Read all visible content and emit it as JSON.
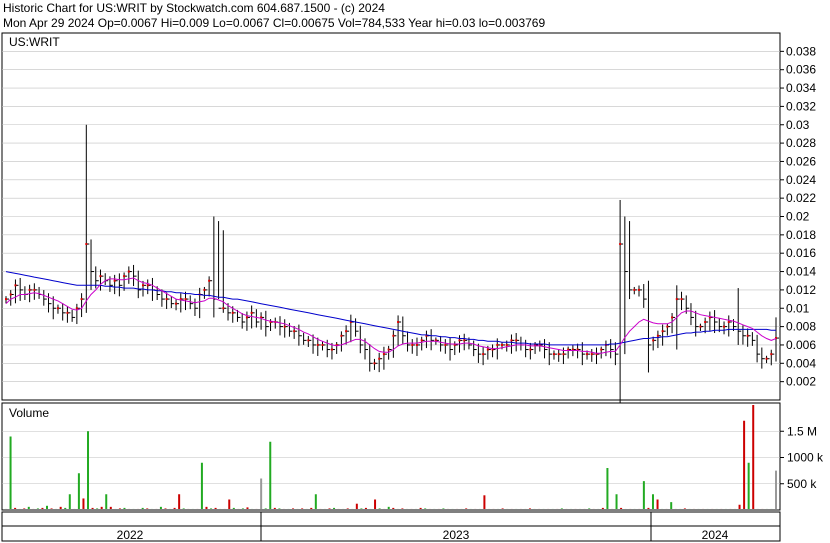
{
  "header": {
    "line1": "Historic Chart for US:WRIT by Stockwatch.com 604.687.1500 - (c) 2024",
    "line2": "Mon Apr 29 2024   Op=0.0067   Hi=0.009   Lo=0.0067   Cl=0.00675   Vol=784,533   Year hi=0.03   lo=0.003769"
  },
  "colors": {
    "price_bar": "#000000",
    "up_dot": "#dd0000",
    "ma_short": "#cc00cc",
    "ma_long": "#0000cc",
    "vol_up": "#22aa22",
    "vol_down": "#cc0000",
    "vol_neutral": "#999999",
    "grid": "#c0c0c0",
    "frame": "#000000"
  },
  "chart_data": [
    {
      "type": "ohlc-line",
      "title": "US:WRIT",
      "ylim": [
        0.0,
        0.04
      ],
      "y_ticks": [
        "0.038",
        "0.036",
        "0.034",
        "0.032",
        "0.03",
        "0.028",
        "0.026",
        "0.024",
        "0.022",
        "0.02",
        "0.018",
        "0.016",
        "0.014",
        "0.012",
        "0.01",
        "0.008",
        "0.006",
        "0.004",
        "0.002"
      ],
      "x_labels": [
        "2022",
        "2023",
        "2024"
      ],
      "grid": true,
      "series": [
        {
          "name": "",
          "kind": "close",
          "values": [
            0.011,
            0.0115,
            0.0125,
            0.012,
            0.0115,
            0.012,
            0.012,
            0.0115,
            0.011,
            0.0105,
            0.01,
            0.01,
            0.0095,
            0.0095,
            0.009,
            0.01,
            0.011,
            0.017,
            0.014,
            0.013,
            0.0135,
            0.013,
            0.0125,
            0.013,
            0.0125,
            0.0135,
            0.014,
            0.0135,
            0.012,
            0.0125,
            0.0125,
            0.012,
            0.0115,
            0.011,
            0.011,
            0.0105,
            0.0105,
            0.011,
            0.011,
            0.0105,
            0.01,
            0.0115,
            0.012,
            0.013,
            0.011,
            0.01,
            0.01,
            0.0095,
            0.0095,
            0.009,
            0.0085,
            0.009,
            0.0095,
            0.0085,
            0.009,
            0.008,
            0.0085,
            0.0085,
            0.008,
            0.008,
            0.0075,
            0.0075,
            0.007,
            0.0065,
            0.0065,
            0.006,
            0.006,
            0.006,
            0.0055,
            0.0055,
            0.006,
            0.007,
            0.0075,
            0.0085,
            0.0075,
            0.006,
            0.0055,
            0.004,
            0.004,
            0.0045,
            0.005,
            0.0055,
            0.007,
            0.0085,
            0.007,
            0.006,
            0.006,
            0.006,
            0.0065,
            0.007,
            0.0065,
            0.0065,
            0.006,
            0.006,
            0.0055,
            0.006,
            0.0065,
            0.0065,
            0.006,
            0.0055,
            0.005,
            0.005,
            0.0055,
            0.0055,
            0.006,
            0.006,
            0.006,
            0.0065,
            0.0065,
            0.006,
            0.0055,
            0.0055,
            0.006,
            0.006,
            0.0055,
            0.005,
            0.005,
            0.005,
            0.005,
            0.0055,
            0.0055,
            0.0055,
            0.005,
            0.005,
            0.005,
            0.005,
            0.0055,
            0.006,
            0.0055,
            0.005,
            0.017,
            0.014,
            0.012,
            0.012,
            0.012,
            0.011,
            0.006,
            0.0065,
            0.007,
            0.0075,
            0.008,
            0.009,
            0.011,
            0.011,
            0.01,
            0.009,
            0.008,
            0.008,
            0.0085,
            0.009,
            0.0085,
            0.008,
            0.008,
            0.0085,
            0.008,
            0.0075,
            0.007,
            0.007,
            0.0065,
            0.005,
            0.0045,
            0.0045,
            0.005,
            0.00675
          ]
        },
        {
          "name": "",
          "kind": "moving-average-short",
          "values": [
            0.0105,
            0.011,
            0.0112,
            0.0115,
            0.0115,
            0.0116,
            0.0117,
            0.0116,
            0.0114,
            0.0112,
            0.011,
            0.0108,
            0.0105,
            0.0102,
            0.0099,
            0.0098,
            0.01,
            0.0108,
            0.0115,
            0.012,
            0.0126,
            0.013,
            0.0132,
            0.0132,
            0.0131,
            0.0131,
            0.0132,
            0.0133,
            0.013,
            0.0128,
            0.0127,
            0.0125,
            0.0122,
            0.0119,
            0.0116,
            0.0113,
            0.011,
            0.0109,
            0.0108,
            0.0107,
            0.0106,
            0.0107,
            0.0108,
            0.0111,
            0.0111,
            0.0109,
            0.0107,
            0.0103,
            0.01,
            0.0097,
            0.0094,
            0.0092,
            0.0091,
            0.009,
            0.0089,
            0.0087,
            0.0086,
            0.0085,
            0.0084,
            0.0083,
            0.0081,
            0.0079,
            0.0077,
            0.0074,
            0.0072,
            0.0069,
            0.0066,
            0.0064,
            0.0062,
            0.006,
            0.0059,
            0.006,
            0.0062,
            0.0064,
            0.0066,
            0.0066,
            0.0064,
            0.006,
            0.0056,
            0.0053,
            0.0052,
            0.0052,
            0.0055,
            0.0059,
            0.0061,
            0.0062,
            0.0062,
            0.0062,
            0.0063,
            0.0064,
            0.0064,
            0.0064,
            0.0063,
            0.0062,
            0.0061,
            0.0061,
            0.0061,
            0.0062,
            0.0062,
            0.0061,
            0.0059,
            0.0058,
            0.0057,
            0.0056,
            0.0056,
            0.0057,
            0.0058,
            0.0059,
            0.006,
            0.006,
            0.006,
            0.0059,
            0.0059,
            0.0059,
            0.0058,
            0.0057,
            0.0056,
            0.0055,
            0.0054,
            0.0054,
            0.0054,
            0.0054,
            0.0053,
            0.0053,
            0.0052,
            0.0051,
            0.0051,
            0.0052,
            0.0053,
            0.0053,
            0.006,
            0.0068,
            0.0075,
            0.008,
            0.0085,
            0.0088,
            0.0086,
            0.0084,
            0.0083,
            0.0083,
            0.0083,
            0.0085,
            0.009,
            0.0095,
            0.0097,
            0.0097,
            0.0095,
            0.0093,
            0.0092,
            0.0091,
            0.009,
            0.0089,
            0.0088,
            0.0087,
            0.0086,
            0.0084,
            0.0082,
            0.008,
            0.0078,
            0.0074,
            0.007,
            0.0067,
            0.0065,
            0.0067
          ]
        },
        {
          "name": "",
          "kind": "moving-average-long",
          "values": [
            0.014,
            0.0139,
            0.0138,
            0.0137,
            0.0136,
            0.0135,
            0.0134,
            0.0133,
            0.0132,
            0.0131,
            0.013,
            0.0129,
            0.0128,
            0.0127,
            0.0126,
            0.0125,
            0.0125,
            0.0125,
            0.0125,
            0.0125,
            0.0125,
            0.0124,
            0.0124,
            0.0123,
            0.0123,
            0.0122,
            0.0122,
            0.0122,
            0.0121,
            0.0121,
            0.012,
            0.012,
            0.0119,
            0.0119,
            0.0118,
            0.0118,
            0.0117,
            0.0117,
            0.0116,
            0.0116,
            0.0115,
            0.0115,
            0.0114,
            0.0114,
            0.0113,
            0.0112,
            0.0112,
            0.0111,
            0.011,
            0.011,
            0.0109,
            0.0108,
            0.0107,
            0.0106,
            0.0105,
            0.0104,
            0.0103,
            0.0102,
            0.0101,
            0.01,
            0.0099,
            0.0098,
            0.0097,
            0.0096,
            0.0095,
            0.0094,
            0.0093,
            0.0092,
            0.0091,
            0.009,
            0.0089,
            0.0088,
            0.0087,
            0.0086,
            0.0085,
            0.0084,
            0.0083,
            0.0082,
            0.0081,
            0.008,
            0.0079,
            0.0078,
            0.0077,
            0.0076,
            0.0075,
            0.0074,
            0.0073,
            0.0072,
            0.0071,
            0.0071,
            0.007,
            0.007,
            0.0069,
            0.0069,
            0.0068,
            0.0068,
            0.0067,
            0.0067,
            0.0066,
            0.0066,
            0.0065,
            0.0065,
            0.0064,
            0.0064,
            0.0064,
            0.0063,
            0.0063,
            0.0063,
            0.0062,
            0.0062,
            0.0062,
            0.0061,
            0.0061,
            0.0061,
            0.0061,
            0.006,
            0.006,
            0.006,
            0.006,
            0.006,
            0.006,
            0.006,
            0.006,
            0.006,
            0.006,
            0.006,
            0.006,
            0.006,
            0.0061,
            0.0061,
            0.0062,
            0.0063,
            0.0064,
            0.0065,
            0.0066,
            0.0067,
            0.0067,
            0.0068,
            0.0068,
            0.0069,
            0.0069,
            0.007,
            0.0071,
            0.0072,
            0.0073,
            0.0073,
            0.0074,
            0.0074,
            0.0075,
            0.0075,
            0.0076,
            0.0076,
            0.0076,
            0.0077,
            0.0077,
            0.0077,
            0.0077,
            0.0077,
            0.0077,
            0.0077,
            0.0077,
            0.0077,
            0.0076,
            0.0076
          ]
        }
      ],
      "spikes": [
        {
          "index": 17,
          "high": 0.03,
          "low": 0.0095
        },
        {
          "index": 18,
          "high": 0.0175,
          "low": 0.012
        },
        {
          "index": 44,
          "high": 0.02,
          "low": 0.009
        },
        {
          "index": 45,
          "high": 0.0195,
          "low": 0.011
        },
        {
          "index": 46,
          "high": 0.0185,
          "low": 0.0095
        },
        {
          "index": 131,
          "high": 0.02,
          "low": 0.005
        },
        {
          "index": 132,
          "high": 0.0195,
          "low": 0.011
        },
        {
          "index": 142,
          "high": 0.0125,
          "low": 0.0055
        },
        {
          "index": 155,
          "high": 0.0122,
          "low": 0.006
        },
        {
          "index": 163,
          "high": 0.009,
          "low": 0.0042
        }
      ]
    },
    {
      "type": "bar",
      "title": "Volume",
      "y_ticks": [
        "1.5 M",
        "1000 k",
        "500 k"
      ],
      "ylim": [
        0,
        2000000
      ],
      "values": [
        20000,
        1400000,
        40000,
        20000,
        30000,
        60000,
        20000,
        30000,
        40000,
        80000,
        30000,
        20000,
        60000,
        40000,
        300000,
        20000,
        700000,
        220000,
        1500000,
        40000,
        30000,
        60000,
        300000,
        60000,
        20000,
        30000,
        40000,
        20000,
        20000,
        20000,
        40000,
        30000,
        20000,
        20000,
        60000,
        30000,
        20000,
        40000,
        300000,
        30000,
        20000,
        20000,
        20000,
        900000,
        60000,
        30000,
        40000,
        20000,
        20000,
        200000,
        40000,
        20000,
        30000,
        50000,
        20000,
        20000,
        600000,
        30000,
        1300000,
        40000,
        30000,
        20000,
        20000,
        30000,
        20000,
        30000,
        20000,
        40000,
        300000,
        20000,
        20000,
        30000,
        40000,
        20000,
        20000,
        30000,
        20000,
        120000,
        30000,
        40000,
        20000,
        200000,
        30000,
        20000,
        60000,
        40000,
        20000,
        30000,
        20000,
        20000,
        20000,
        40000,
        30000,
        20000,
        20000,
        20000,
        30000,
        20000,
        20000,
        20000,
        20000,
        30000,
        20000,
        20000,
        20000,
        280000,
        20000,
        20000,
        20000,
        30000,
        20000,
        20000,
        20000,
        20000,
        20000,
        30000,
        20000,
        20000,
        20000,
        20000,
        20000,
        20000,
        30000,
        20000,
        20000,
        20000,
        20000,
        20000,
        30000,
        20000,
        20000,
        40000,
        800000,
        20000,
        300000,
        40000,
        20000,
        20000,
        20000,
        20000,
        550000,
        40000,
        300000,
        200000,
        20000,
        20000,
        150000,
        20000,
        20000,
        30000,
        20000,
        20000,
        20000,
        20000,
        20000,
        20000,
        20000,
        20000,
        20000,
        20000,
        20000,
        100000,
        1700000,
        900000,
        2000000,
        20000,
        20000,
        20000,
        20000,
        750000
      ],
      "colors": [
        "g",
        "g",
        "r",
        "g",
        "r",
        "g",
        "r",
        "g",
        "r",
        "g",
        "r",
        "g",
        "r",
        "g",
        "g",
        "r",
        "g",
        "r",
        "g",
        "r",
        "g",
        "r",
        "g",
        "r",
        "g",
        "r",
        "g",
        "r",
        "g",
        "r",
        "g",
        "r",
        "g",
        "r",
        "g",
        "r",
        "g",
        "r",
        "r",
        "g",
        "r",
        "g",
        "r",
        "g",
        "r",
        "g",
        "r",
        "g",
        "r",
        "r",
        "g",
        "r",
        "g",
        "r",
        "g",
        "r",
        "x",
        "g",
        "g",
        "r",
        "g",
        "r",
        "g",
        "r",
        "g",
        "r",
        "g",
        "r",
        "g",
        "r",
        "g",
        "r",
        "g",
        "r",
        "g",
        "r",
        "g",
        "r",
        "g",
        "r",
        "g",
        "r",
        "g",
        "r",
        "g",
        "r",
        "g",
        "r",
        "g",
        "r",
        "g",
        "r",
        "g",
        "r",
        "g",
        "r",
        "g",
        "r",
        "g",
        "r",
        "g",
        "r",
        "g",
        "r",
        "g",
        "r",
        "g",
        "r",
        "g",
        "r",
        "g",
        "r",
        "g",
        "r",
        "g",
        "r",
        "g",
        "r",
        "g",
        "r",
        "g",
        "r",
        "g",
        "r",
        "g",
        "r",
        "g",
        "r",
        "g",
        "r",
        "g",
        "r",
        "g",
        "r",
        "g",
        "r",
        "g",
        "r",
        "g",
        "r",
        "g",
        "r",
        "g",
        "r",
        "g",
        "r",
        "g",
        "r",
        "g",
        "r",
        "g",
        "r",
        "g",
        "r",
        "g",
        "r",
        "g",
        "r",
        "g",
        "r",
        "g",
        "r",
        "r",
        "g",
        "r",
        "g",
        "r",
        "g",
        "g"
      ]
    }
  ],
  "volume_label": "Volume"
}
